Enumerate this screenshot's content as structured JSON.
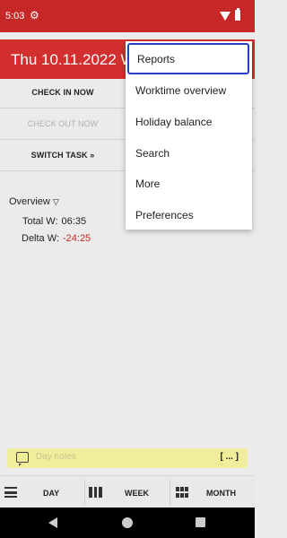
{
  "status_bar": {
    "time": "5:03",
    "gear_icon": "gear-icon",
    "wifi_icon": "wifi-icon",
    "battery_icon": "battery-icon"
  },
  "app_bar": {
    "title": "Thu 10.11.2022 W4"
  },
  "actions": {
    "check_in": "CHECK IN NOW",
    "check_out": "CHECK OUT NOW",
    "switch_task": "SWITCH TASK »"
  },
  "overview": {
    "label": "Overview",
    "arrow": "▽",
    "total_label": "Total W:",
    "total_value": "06:35",
    "delta_label": "Delta W:",
    "delta_value": "-24:25"
  },
  "notes": {
    "placeholder": "Day notes",
    "expand": "[ ... ]"
  },
  "bottom_nav": {
    "day": "DAY",
    "week": "WEEK",
    "month": "MONTH"
  },
  "menu": {
    "items": [
      {
        "label": "Reports",
        "selected": true
      },
      {
        "label": "Worktime overview"
      },
      {
        "label": "Holiday balance"
      },
      {
        "label": "Search"
      },
      {
        "label": "More"
      },
      {
        "label": "Preferences"
      }
    ]
  },
  "colors": {
    "primary": "#d32f2f",
    "status_bar": "#c62828",
    "negative": "#c62828",
    "notes_bg": "#f0ee9a",
    "focus": "#2b3ec8"
  }
}
